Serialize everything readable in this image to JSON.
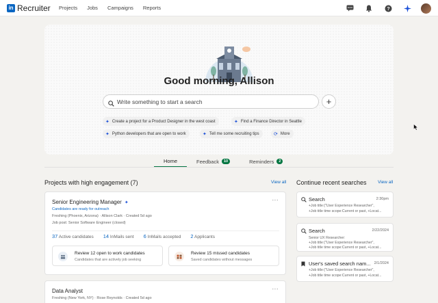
{
  "nav": {
    "logo_letter": "in",
    "logo_text": "Recruiter",
    "links": [
      "Projects",
      "Jobs",
      "Campaigns",
      "Reports"
    ],
    "icons": [
      "message-icon",
      "bell-icon",
      "help-icon",
      "sparkle-icon",
      "avatar"
    ]
  },
  "hero": {
    "greeting": "Good morning, Allison",
    "search_placeholder": "Write something to start a search",
    "chips": [
      "Create a project for a Product Designer in the west coast",
      "Find a Finance Director in Seattle",
      "Python developers that are open to work",
      "Tell me some recruiting tips",
      "More"
    ]
  },
  "tabs": [
    {
      "label": "Home",
      "badge": ""
    },
    {
      "label": "Feedback",
      "badge": "10"
    },
    {
      "label": "Reminders",
      "badge": "2"
    }
  ],
  "projects": {
    "title": "Projects with high engagement (7)",
    "view_all": "View all",
    "card1": {
      "title": "Senior Engineering Manager",
      "status": "Candidates are ready for outreach",
      "meta1": "Freshing (Phoenix, Arizona) · Allison Clark · Created 5d ago",
      "meta2": "Job post: Senior Software Engineer (closed)",
      "stats": [
        {
          "num": "37",
          "label": "Active candidates"
        },
        {
          "num": "14",
          "label": "InMails sent"
        },
        {
          "num": "6",
          "label": "InMails accepted"
        },
        {
          "num": "2",
          "label": "Applicants"
        }
      ],
      "actions": [
        {
          "title": "Review 12 open to work candidates",
          "sub": "Candidates that are actively job seeking"
        },
        {
          "title": "Review 15 missed candidates",
          "sub": "Saved candidates without messages"
        }
      ]
    },
    "card2": {
      "title": "Data Analyst",
      "meta1": "Freshing (New York, NY) · Rose Reynolds · Created 5d ago"
    }
  },
  "searches": {
    "title": "Continue recent searches",
    "view_all": "View all",
    "items": [
      {
        "title": "Search",
        "date": "2:30pm",
        "lines": [
          "+Job title:(\"User Experience Researcher\",",
          "+Job title time scope:Current or past, +Locat..."
        ]
      },
      {
        "title": "Search",
        "date": "2/22/2024",
        "lines": [
          "Senior UX Researcher:",
          "+Job title:(\"User Experience Researcher\",",
          "+Job title time scope:Current or past, +Locat..."
        ]
      },
      {
        "title": "User's saved search nam...",
        "date": "2/1/2024",
        "lines": [
          "+Job title:(\"User Experience Researcher\",",
          "+Job title time scope:Current or past, +Locat..."
        ]
      }
    ]
  }
}
